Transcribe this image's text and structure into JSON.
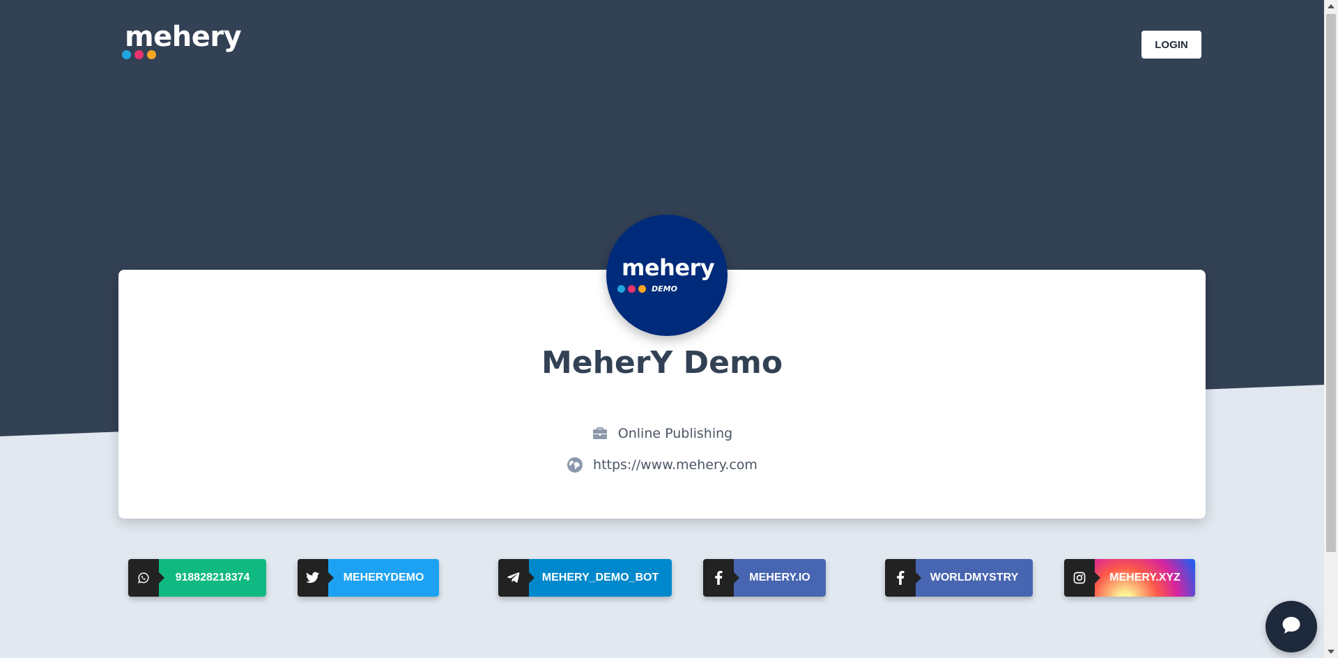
{
  "brand": {
    "name": "mehery",
    "dot_colors": [
      "#22a6e0",
      "#e8336f",
      "#f5a623"
    ]
  },
  "header": {
    "login_label": "LOGIN"
  },
  "profile": {
    "avatar_brand": "mehery",
    "avatar_sub": "DEMO",
    "avatar_bg": "#002a7a",
    "name": "MeherY Demo",
    "category_icon": "briefcase-icon",
    "category": "Online Publishing",
    "website_icon": "globe-icon",
    "website": "https://www.mehery.com"
  },
  "social_links": [
    {
      "platform": "whatsapp",
      "icon": "whatsapp-icon",
      "label": "918828218374",
      "color": "#10b981"
    },
    {
      "platform": "twitter",
      "icon": "twitter-icon",
      "label": "MEHERYDEMO",
      "color": "#1da1f2"
    },
    {
      "platform": "telegram",
      "icon": "telegram-icon",
      "label": "MEHERY_DEMO_BOT",
      "color": "#0088cc"
    },
    {
      "platform": "facebook",
      "icon": "facebook-icon",
      "label": "MEHERY.IO",
      "color": "#3b5998"
    },
    {
      "platform": "facebook",
      "icon": "facebook-icon",
      "label": "WORLDMYSTRY",
      "color": "#3b5998"
    },
    {
      "platform": "instagram",
      "icon": "instagram-icon",
      "label": "MEHERY.XYZ",
      "color": "#e1306c"
    }
  ],
  "chat": {
    "icon": "chat-bubble-icon"
  },
  "colors": {
    "header_bg": "#334155",
    "page_bg": "#e2e8f0",
    "text_dark": "#334155"
  }
}
